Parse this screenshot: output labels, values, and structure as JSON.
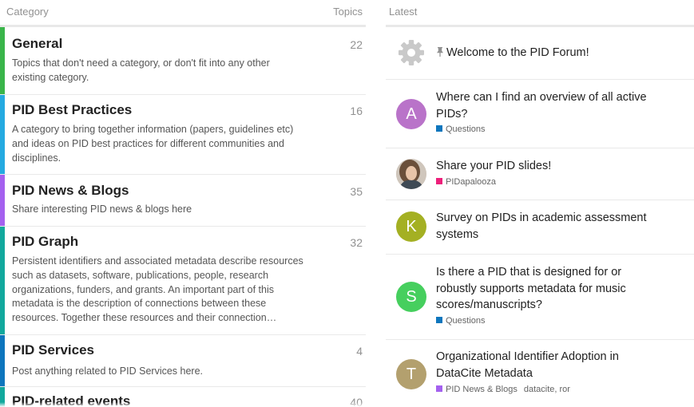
{
  "categories_header": {
    "category_label": "Category",
    "topics_label": "Topics"
  },
  "categories": [
    {
      "name": "General",
      "description": "Topics that don't need a category, or don't fit into any other existing category.",
      "topics": "22",
      "color": "#3ab54a"
    },
    {
      "name": "PID Best Practices",
      "description": "A category to bring together information (papers, guidelines etc) and ideas on PID best practices for different communities and disciplines.",
      "topics": "16",
      "color": "#25aae1"
    },
    {
      "name": "PID News & Blogs",
      "description": "Share interesting PID news & blogs here",
      "topics": "35",
      "color": "#a461ef"
    },
    {
      "name": "PID Graph",
      "description": "Persistent identifiers and associated metadata describe resources such as datasets, software, publications, people, research organizations, funders, and grants. An important part of this metadata is the description of connections between these resources. Together these resources and their connection…",
      "topics": "32",
      "color": "#12a89d"
    },
    {
      "name": "PID Services",
      "description": "Post anything related to PID Services here.",
      "topics": "4",
      "color": "#0e76bd"
    },
    {
      "name": "PID-related events",
      "description": "",
      "topics": "40",
      "color": "#12a89d"
    }
  ],
  "latest_header": {
    "label": "Latest"
  },
  "latest": [
    {
      "pin_glyph": "📌",
      "title": "Welcome to the PID Forum!",
      "avatar_type": "gear-icon"
    },
    {
      "title": "Where can I find an overview of all active PIDs?",
      "avatar_letter": "A",
      "avatar_color": "#b973c9",
      "category": "Questions",
      "category_color": "#0e76bd"
    },
    {
      "title": "Share your PID slides!",
      "avatar_type": "user-photo",
      "category": "PIDapalooza",
      "category_color": "#ed207b"
    },
    {
      "title": "Survey on PIDs in academic assessment systems",
      "avatar_letter": "K",
      "avatar_color": "#a4b023"
    },
    {
      "title": "Is there a PID that is designed for or robustly supports metadata for music scores/manuscripts?",
      "avatar_letter": "S",
      "avatar_color": "#46cf5e",
      "category": "Questions",
      "category_color": "#0e76bd"
    },
    {
      "title": "Organizational Identifier Adoption in DataCite Metadata",
      "avatar_letter": "T",
      "avatar_color": "#b3a06e",
      "category": "PID News & Blogs",
      "category_color": "#a461ef",
      "tags": "datacite, ror"
    }
  ]
}
